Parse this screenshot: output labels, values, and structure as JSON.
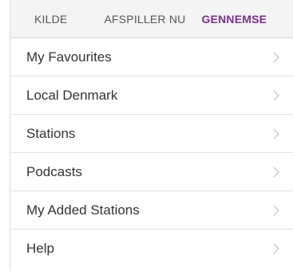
{
  "tabs": [
    {
      "label": "KILDE",
      "active": false
    },
    {
      "label": "AFSPILLER NU",
      "active": false
    },
    {
      "label": "GENNEMSE",
      "active": true
    }
  ],
  "colors": {
    "active_tab": "#7b2d8e",
    "tab_bar_bg": "#f4f4f4",
    "text": "#333333",
    "chevron": "#c7c7cc"
  },
  "browse_items": [
    {
      "label": "My Favourites",
      "icon": "chevron-right-icon"
    },
    {
      "label": "Local Denmark",
      "icon": "chevron-right-icon"
    },
    {
      "label": "Stations",
      "icon": "chevron-right-icon"
    },
    {
      "label": "Podcasts",
      "icon": "chevron-right-icon"
    },
    {
      "label": "My Added Stations",
      "icon": "chevron-right-icon"
    },
    {
      "label": "Help",
      "icon": "chevron-right-icon"
    }
  ]
}
